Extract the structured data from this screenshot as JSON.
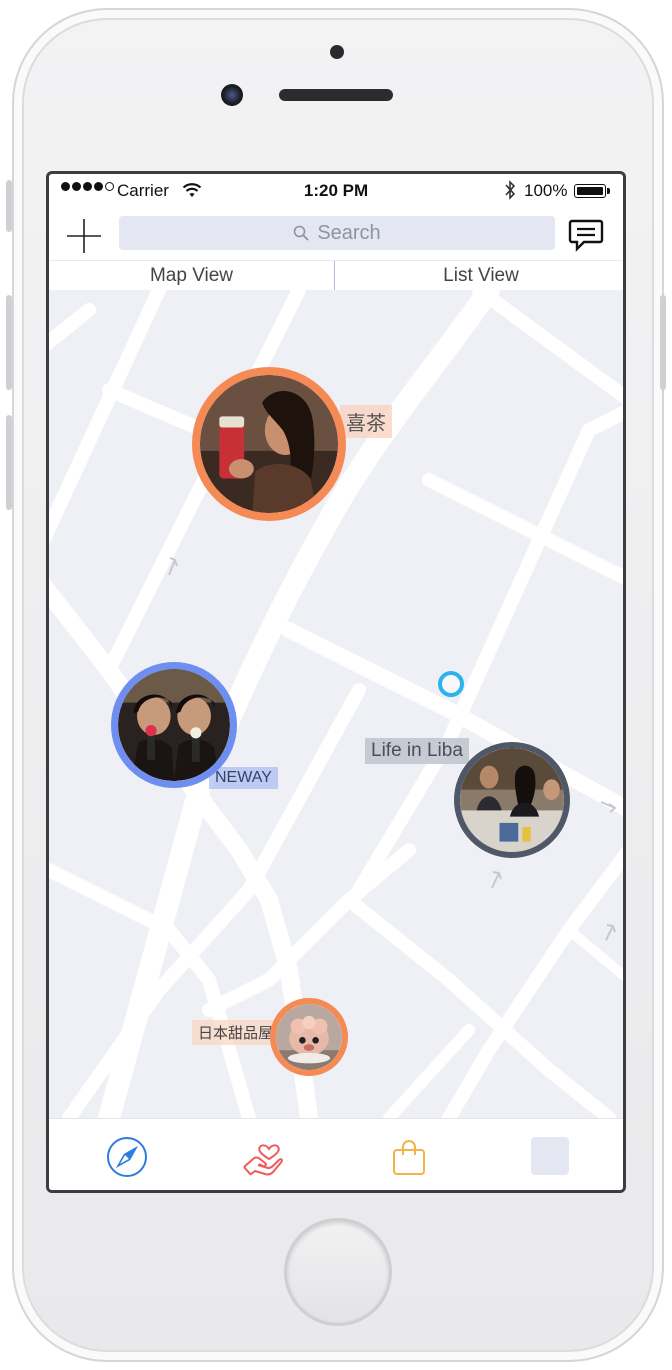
{
  "status_bar": {
    "carrier": "Carrier",
    "time": "1:20 PM",
    "battery": "100%"
  },
  "nav": {
    "search_placeholder": "Search"
  },
  "segments": {
    "map_view": "Map View",
    "list_view": "List View"
  },
  "map": {
    "pins": [
      {
        "label": "喜茶",
        "ring_color": "#f58a54"
      },
      {
        "label": "NEWAY",
        "ring_color": "#6f8ff0"
      },
      {
        "label": "Life in Liba",
        "ring_color": "#4f5866"
      },
      {
        "label": "日本甜品屋",
        "ring_color": "#f58a54"
      }
    ],
    "location_color": "#2bb4ec"
  },
  "tabs": [
    {
      "icon": "compass-icon",
      "color": "#2b7de0"
    },
    {
      "icon": "heart-hand-icon",
      "color": "#ef5a5a"
    },
    {
      "icon": "shopping-bag-icon",
      "color": "#f5b14a"
    },
    {
      "icon": "profile-placeholder-icon",
      "color": "#e4e7f1"
    }
  ]
}
